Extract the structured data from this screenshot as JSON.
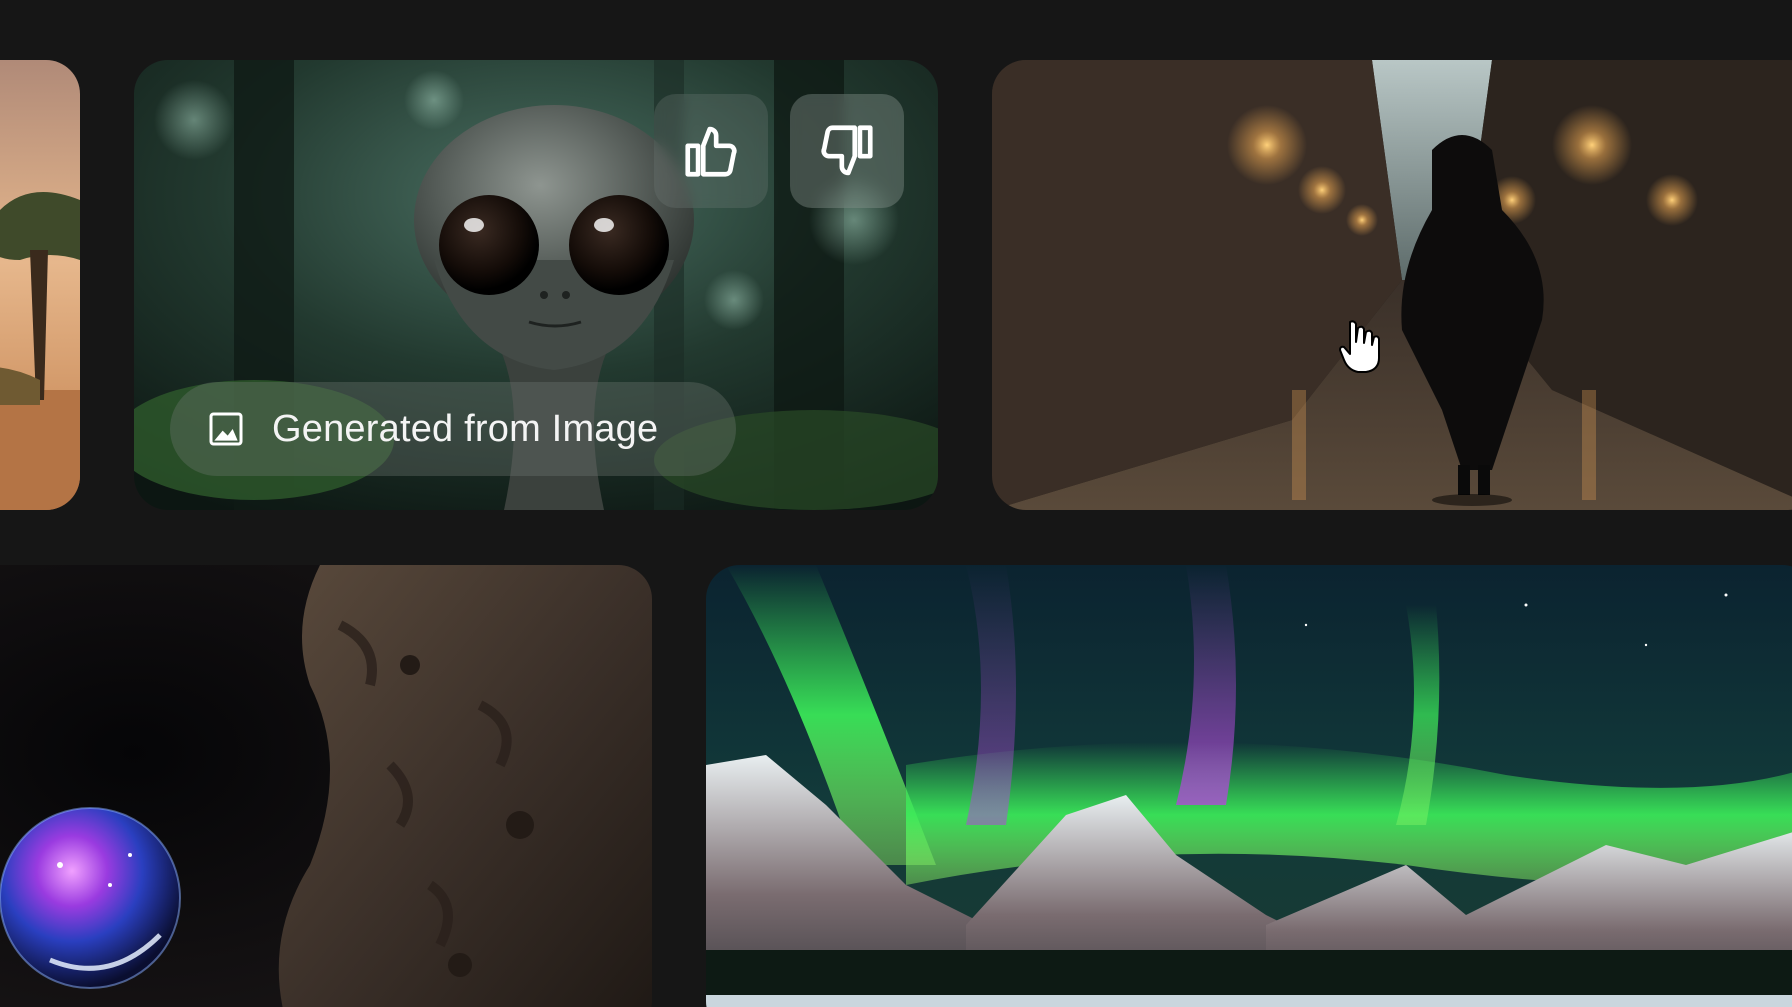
{
  "gallery": {
    "cards": [
      {
        "name": "savanna-tree",
        "accent": "#c98a55"
      },
      {
        "name": "alien-forest",
        "accent": "#2f5a4c"
      },
      {
        "name": "hooded-figure-alley",
        "accent": "#e0a050"
      },
      {
        "name": "cave-cosmic-orb",
        "accent": "#8a3bd8"
      },
      {
        "name": "aurora-mountains",
        "accent": "#3cf05a"
      }
    ],
    "alien_card": {
      "like_icon": "thumbs-up-icon",
      "dislike_icon": "thumbs-down-icon",
      "source_badge_icon": "image-icon",
      "source_badge_label": "Generated from Image"
    }
  },
  "colors": {
    "background": "#161616",
    "pill_text": "#f4f4f4"
  }
}
